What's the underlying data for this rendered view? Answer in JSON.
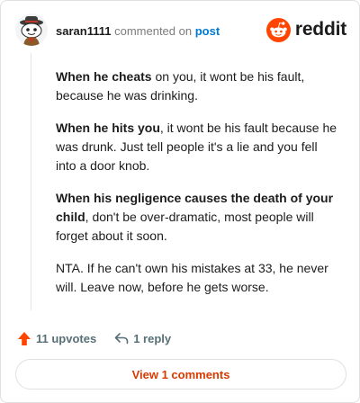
{
  "comment": {
    "username": "saran1111",
    "action_text": "commented on",
    "target_link": "post",
    "brand": "reddit",
    "paragraphs": [
      {
        "bold": "When he cheats",
        "rest": " on you, it wont be his fault, because he was drinking."
      },
      {
        "bold": "When he hits you",
        "rest": ", it wont be his fault because he was drunk. Just tell people it's a lie and you fell into a door knob."
      },
      {
        "bold": "When his negligence causes the death of your child",
        "rest": ", don't be over-dramatic, most people will forget about it soon."
      },
      {
        "bold": "",
        "rest": "NTA. If he can't own his mistakes at 33, he never will. Leave now, before he gets worse."
      }
    ],
    "upvotes_label": "11 upvotes",
    "reply_label": "1 reply",
    "view_comments_label": "View 1 comments"
  },
  "colors": {
    "accent": "#d93a00",
    "upvote": "#ff4500",
    "link": "#0079d3"
  },
  "icons": {
    "logo": "reddit-snoo-icon",
    "upvote": "upvote-arrow-icon",
    "reply": "reply-arrow-icon",
    "avatar": "snoo-avatar-icon"
  }
}
